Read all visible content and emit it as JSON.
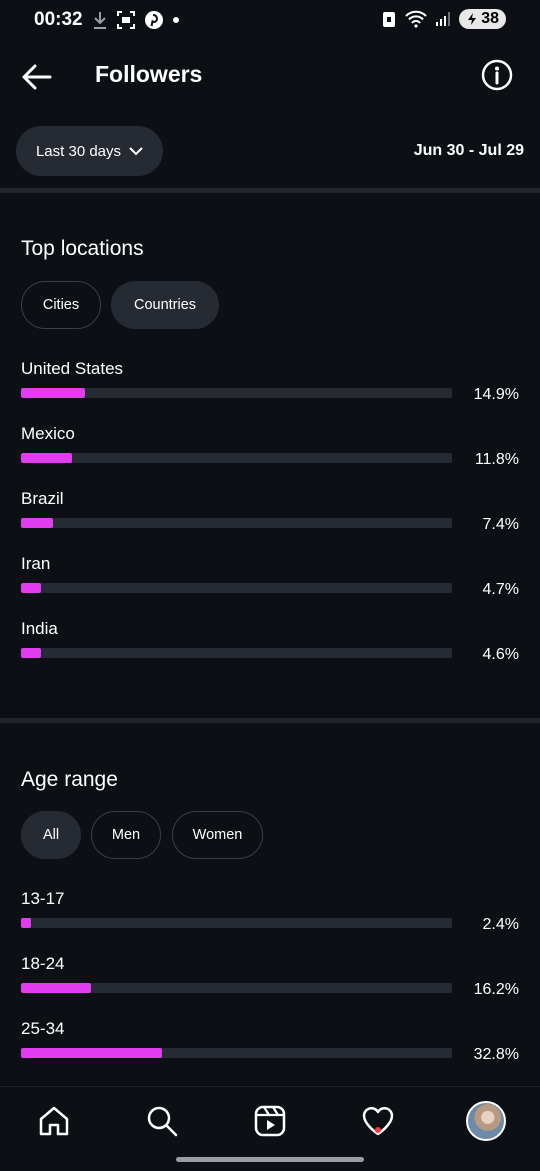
{
  "status_bar": {
    "time": "00:32",
    "battery": "38",
    "icons_left": [
      "download-icon",
      "screenshot-icon",
      "pinterest-icon",
      "dot-icon"
    ],
    "icons_right": [
      "data-saver-icon",
      "wifi-icon",
      "signal-icon",
      "battery-icon"
    ]
  },
  "header": {
    "title": "Followers",
    "back_icon": "arrow-left-icon",
    "info_icon": "info-icon"
  },
  "filter": {
    "range_label": "Last 30 days",
    "date_range": "Jun 30 - Jul 29"
  },
  "locations": {
    "title": "Top locations",
    "chips": [
      {
        "label": "Cities",
        "selected": false
      },
      {
        "label": "Countries",
        "selected": true
      }
    ],
    "items": [
      {
        "label": "United States",
        "value": "14.9%",
        "fill": 0.149
      },
      {
        "label": "Mexico",
        "value": "11.8%",
        "fill": 0.118
      },
      {
        "label": "Brazil",
        "value": "7.4%",
        "fill": 0.074
      },
      {
        "label": "Iran",
        "value": "4.7%",
        "fill": 0.047
      },
      {
        "label": "India",
        "value": "4.6%",
        "fill": 0.046
      }
    ]
  },
  "age": {
    "title": "Age range",
    "chips": [
      {
        "label": "All",
        "selected": true
      },
      {
        "label": "Men",
        "selected": false
      },
      {
        "label": "Women",
        "selected": false
      }
    ],
    "items": [
      {
        "label": "13-17",
        "value": "2.4%",
        "fill": 0.024
      },
      {
        "label": "18-24",
        "value": "16.2%",
        "fill": 0.162
      },
      {
        "label": "25-34",
        "value": "32.8%",
        "fill": 0.328
      }
    ]
  },
  "colors": {
    "background": "#0c0f14",
    "bar_fill": "#e23cf0",
    "bar_track": "#262a33",
    "notification_dot": "#ff3040"
  },
  "bottom_nav": {
    "items": [
      "home-icon",
      "search-icon",
      "reels-icon",
      "heart-icon",
      "profile-avatar"
    ]
  }
}
